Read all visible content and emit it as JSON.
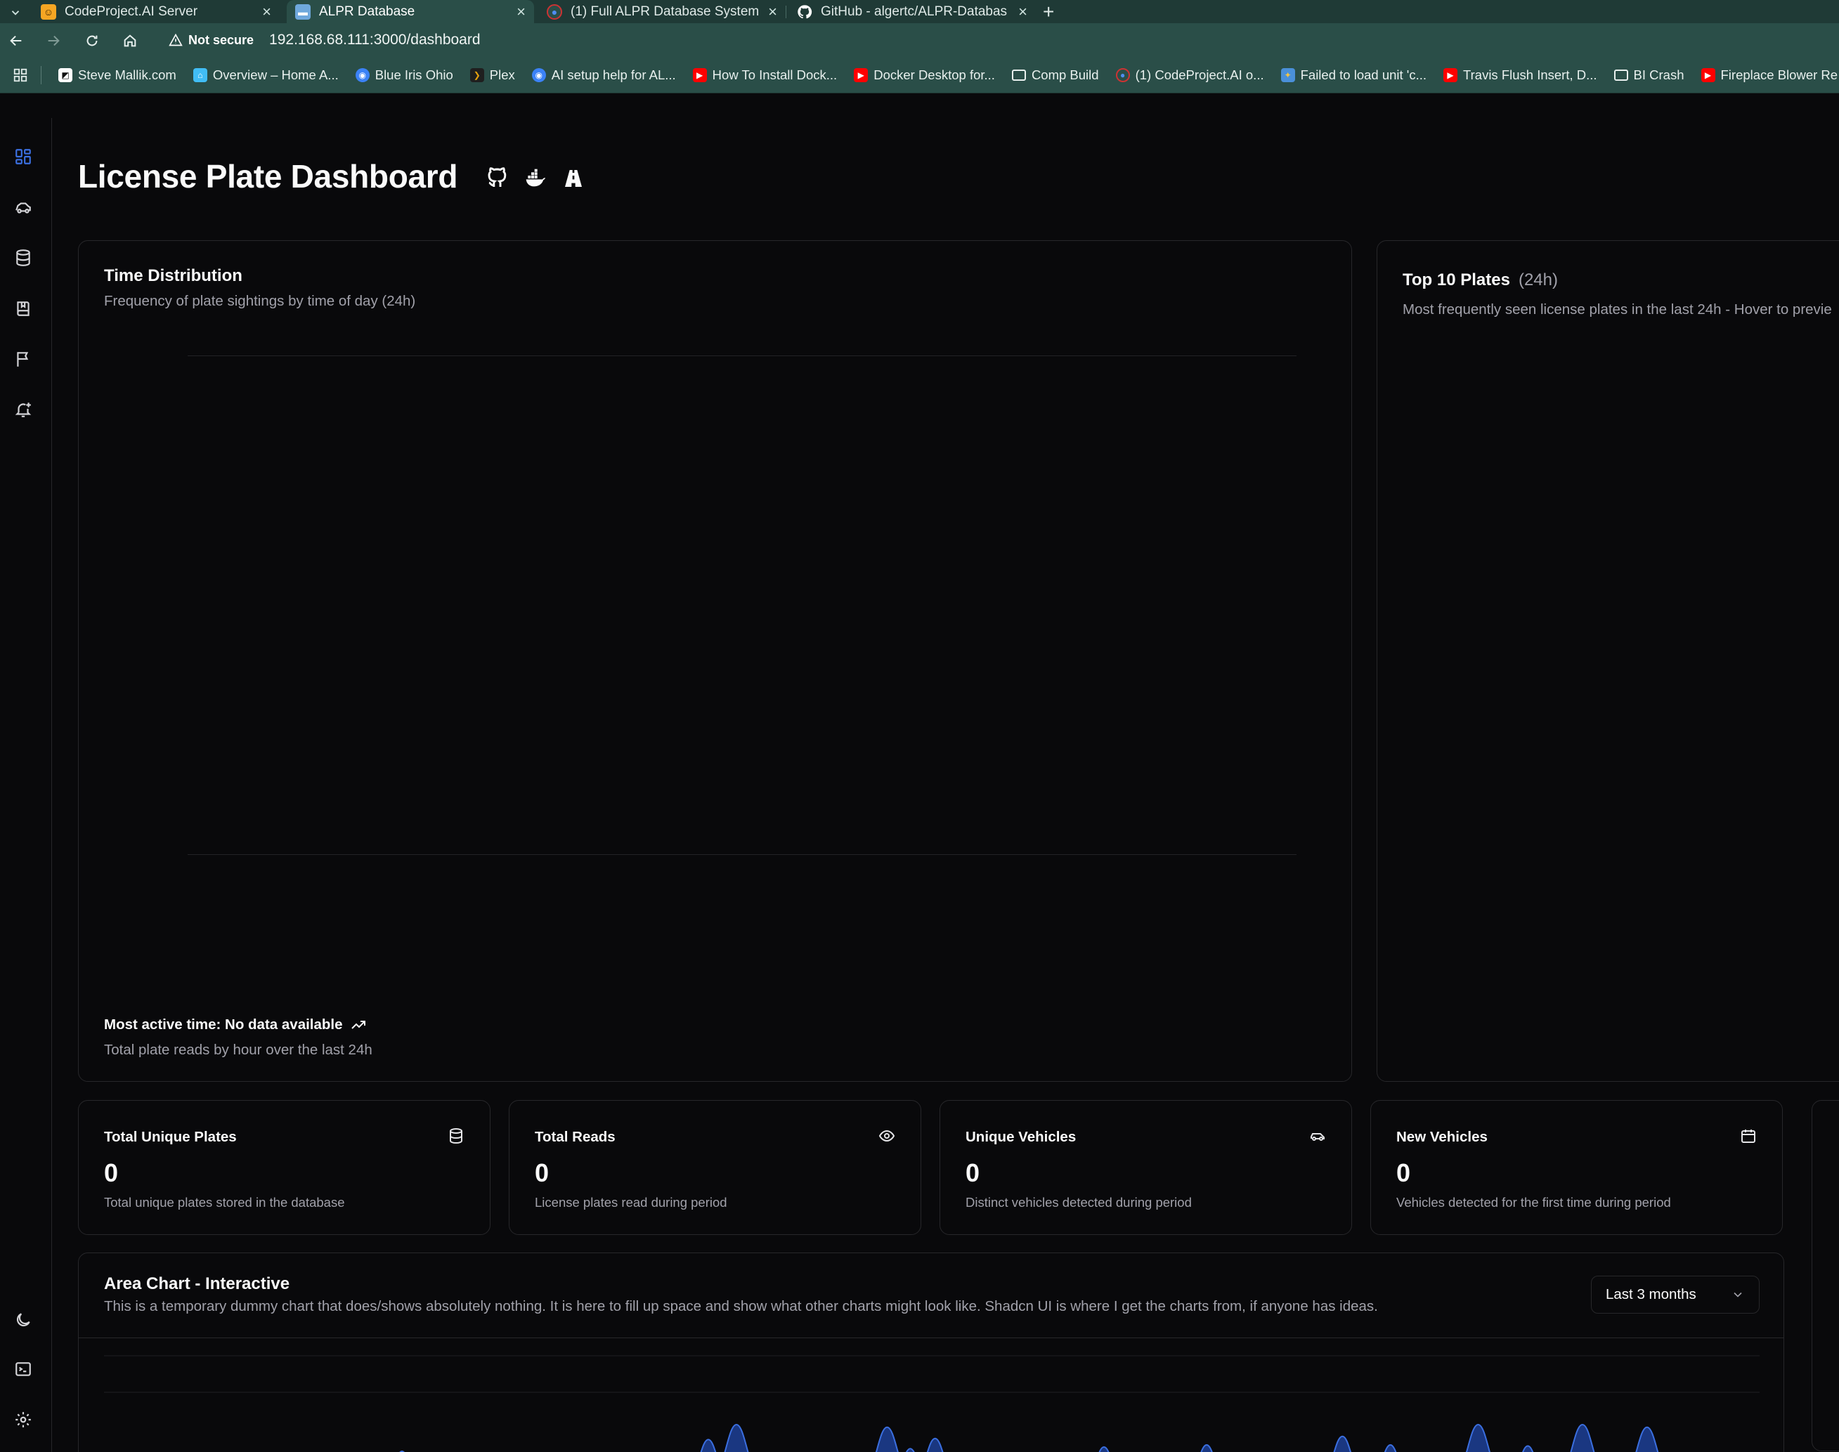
{
  "browser": {
    "tabs": [
      {
        "label": "CodeProject.AI Server",
        "active": false
      },
      {
        "label": "ALPR Database",
        "active": true
      },
      {
        "label": "(1) Full ALPR Database System f",
        "active": false
      },
      {
        "label": "GitHub - algertc/ALPR-Databas",
        "active": false
      }
    ],
    "security_label": "Not secure",
    "url": "192.168.68.111:3000/dashboard",
    "bookmarks": [
      {
        "label": "Steve Mallik.com",
        "icon": "site-icon"
      },
      {
        "label": "Overview – Home A...",
        "icon": "home-assistant-icon"
      },
      {
        "label": "Blue Iris Ohio",
        "icon": "blue-iris-icon"
      },
      {
        "label": "Plex",
        "icon": "plex-icon"
      },
      {
        "label": "AI setup help for AL...",
        "icon": "blue-iris-icon"
      },
      {
        "label": "How To Install Dock...",
        "icon": "youtube-icon"
      },
      {
        "label": "Docker Desktop for...",
        "icon": "youtube-icon"
      },
      {
        "label": "Comp Build",
        "icon": "folder-icon"
      },
      {
        "label": "(1) CodeProject.AI o...",
        "icon": "codeproject-icon"
      },
      {
        "label": "Failed to load unit 'c...",
        "icon": "site-icon"
      },
      {
        "label": "Travis Flush Insert, D...",
        "icon": "youtube-icon"
      },
      {
        "label": "BI Crash",
        "icon": "folder-icon"
      },
      {
        "label": "Fireplace Blower Re",
        "icon": "youtube-icon"
      }
    ]
  },
  "page": {
    "title": "License Plate Dashboard"
  },
  "time_distribution": {
    "title": "Time Distribution",
    "description": "Frequency of plate sightings by time of day (24h)",
    "footer_main": "Most active time: No data available",
    "footer_sub": "Total plate reads by hour over the last 24h"
  },
  "top_plates": {
    "title": "Top 10 Plates",
    "subtitle": "(24h)",
    "description": "Most frequently seen license plates in the last 24h - Hover to previe"
  },
  "stats": [
    {
      "title": "Total Unique Plates",
      "value": "0",
      "description": "Total unique plates stored in the database",
      "icon": "database-icon"
    },
    {
      "title": "Total Reads",
      "value": "0",
      "description": "License plates read during period",
      "icon": "eye-icon"
    },
    {
      "title": "Unique Vehicles",
      "value": "0",
      "description": "Distinct vehicles detected during period",
      "icon": "car-icon"
    },
    {
      "title": "New Vehicles",
      "value": "0",
      "description": "Vehicles detected for the first time during period",
      "icon": "calendar-icon"
    }
  ],
  "area_chart": {
    "title": "Area Chart - Interactive",
    "description": "This is a temporary dummy chart that does/shows absolutely nothing. It is here to fill up space and show what other charts might look like. Shadcn UI is where I get the charts from, if anyone has ideas.",
    "range_label": "Last 3 months",
    "peaks": [
      {
        "x": 0.05,
        "v": 0.04
      },
      {
        "x": 0.075,
        "v": 0.13
      },
      {
        "x": 0.13,
        "v": 0.09
      },
      {
        "x": 0.18,
        "v": 0.5
      },
      {
        "x": 0.283,
        "v": 0.3
      },
      {
        "x": 0.313,
        "v": 0.46
      },
      {
        "x": 0.365,
        "v": 0.72
      },
      {
        "x": 0.382,
        "v": 1.0
      },
      {
        "x": 0.473,
        "v": 0.95
      },
      {
        "x": 0.487,
        "v": 0.55
      },
      {
        "x": 0.502,
        "v": 0.74
      },
      {
        "x": 0.604,
        "v": 0.58
      },
      {
        "x": 0.666,
        "v": 0.62
      },
      {
        "x": 0.686,
        "v": 0.4
      },
      {
        "x": 0.735,
        "v": 0.35
      },
      {
        "x": 0.748,
        "v": 0.78
      },
      {
        "x": 0.777,
        "v": 0.62
      },
      {
        "x": 0.8,
        "v": 0.45
      },
      {
        "x": 0.83,
        "v": 1.0
      },
      {
        "x": 0.86,
        "v": 0.6
      },
      {
        "x": 0.893,
        "v": 1.0
      },
      {
        "x": 0.932,
        "v": 0.95
      },
      {
        "x": 0.983,
        "v": 0.45
      }
    ]
  },
  "colors": {
    "background": "#09090b",
    "border": "#27272a",
    "muted_text": "#a1a1aa",
    "accent": "#3b6fe0",
    "area_fill": "#1d3f96",
    "area_stroke": "#3b6fe0",
    "browser_frame": "#2a4e48"
  }
}
